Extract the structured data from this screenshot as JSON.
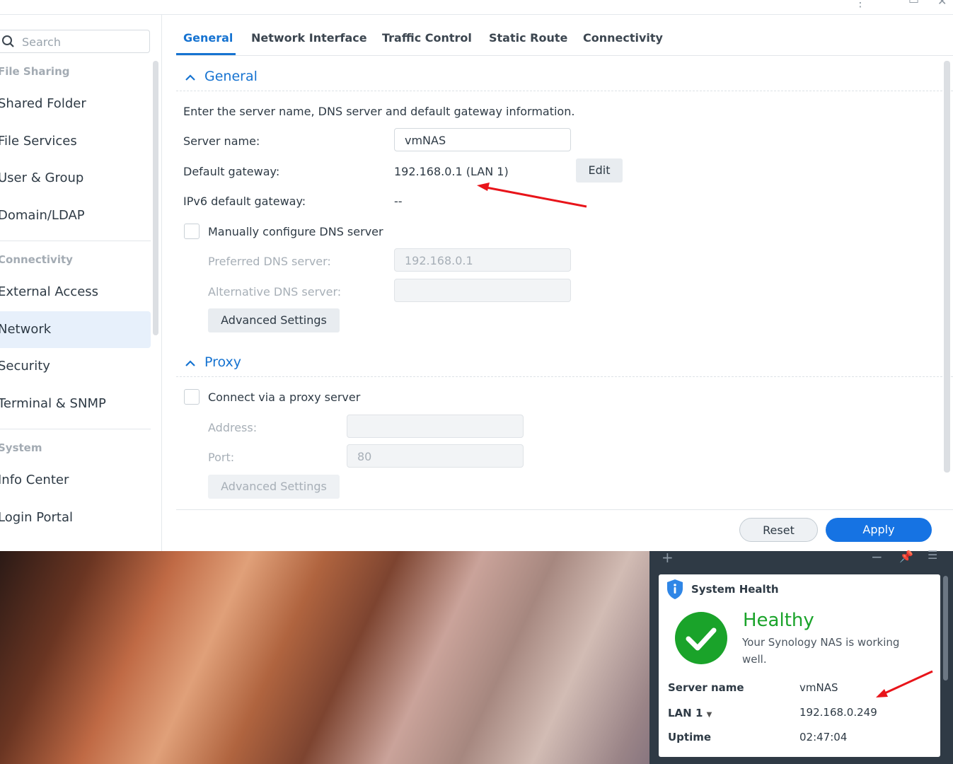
{
  "sidebar": {
    "search_placeholder": "Search",
    "sections": {
      "file_sharing": "File Sharing",
      "connectivity": "Connectivity",
      "system": "System"
    },
    "items": {
      "shared_folder": "Shared Folder",
      "file_services": "File Services",
      "user_group": "User & Group",
      "domain_ldap": "Domain/LDAP",
      "external_access": "External Access",
      "network": "Network",
      "security": "Security",
      "terminal_snmp": "Terminal & SNMP",
      "info_center": "Info Center",
      "login_portal": "Login Portal"
    }
  },
  "tabs": {
    "general": "General",
    "network_interface": "Network Interface",
    "traffic_control": "Traffic Control",
    "static_route": "Static Route",
    "connectivity": "Connectivity"
  },
  "general": {
    "heading": "General",
    "description": "Enter the server name, DNS server and default gateway information.",
    "server_name_label": "Server name:",
    "server_name_value": "vmNAS",
    "default_gateway_label": "Default gateway:",
    "default_gateway_value": "192.168.0.1 (LAN 1)",
    "edit_label": "Edit",
    "ipv6_label": "IPv6 default gateway:",
    "ipv6_value": "--",
    "manual_dns_label": "Manually configure DNS server",
    "preferred_dns_label": "Preferred DNS server:",
    "preferred_dns_placeholder": "192.168.0.1",
    "alternative_dns_label": "Alternative DNS server:",
    "advanced_settings_label": "Advanced Settings"
  },
  "proxy": {
    "heading": "Proxy",
    "connect_label": "Connect via a proxy server",
    "address_label": "Address:",
    "port_label": "Port:",
    "port_placeholder": "80",
    "advanced_settings_label": "Advanced Settings"
  },
  "footer": {
    "reset_label": "Reset",
    "apply_label": "Apply"
  },
  "widget": {
    "title": "System Health",
    "status": "Healthy",
    "status_sub": "Your Synology NAS is working well.",
    "rows": {
      "server_name_key": "Server name",
      "server_name_val": "vmNAS",
      "lan_key": "LAN 1",
      "lan_val": "192.168.0.249",
      "uptime_key": "Uptime",
      "uptime_val": "02:47:04"
    }
  },
  "colors": {
    "accent": "#1673d1",
    "apply": "#1673e3",
    "healthy": "#1aa32a",
    "annotation_arrow": "#e8141a"
  },
  "icons": [
    "search-icon",
    "chevron-up-icon",
    "info-shield-icon",
    "check-circle-icon",
    "caret-down-icon",
    "plus-icon",
    "minus-icon",
    "pin-icon",
    "menu-icon",
    "close-icon",
    "maximize-icon"
  ]
}
